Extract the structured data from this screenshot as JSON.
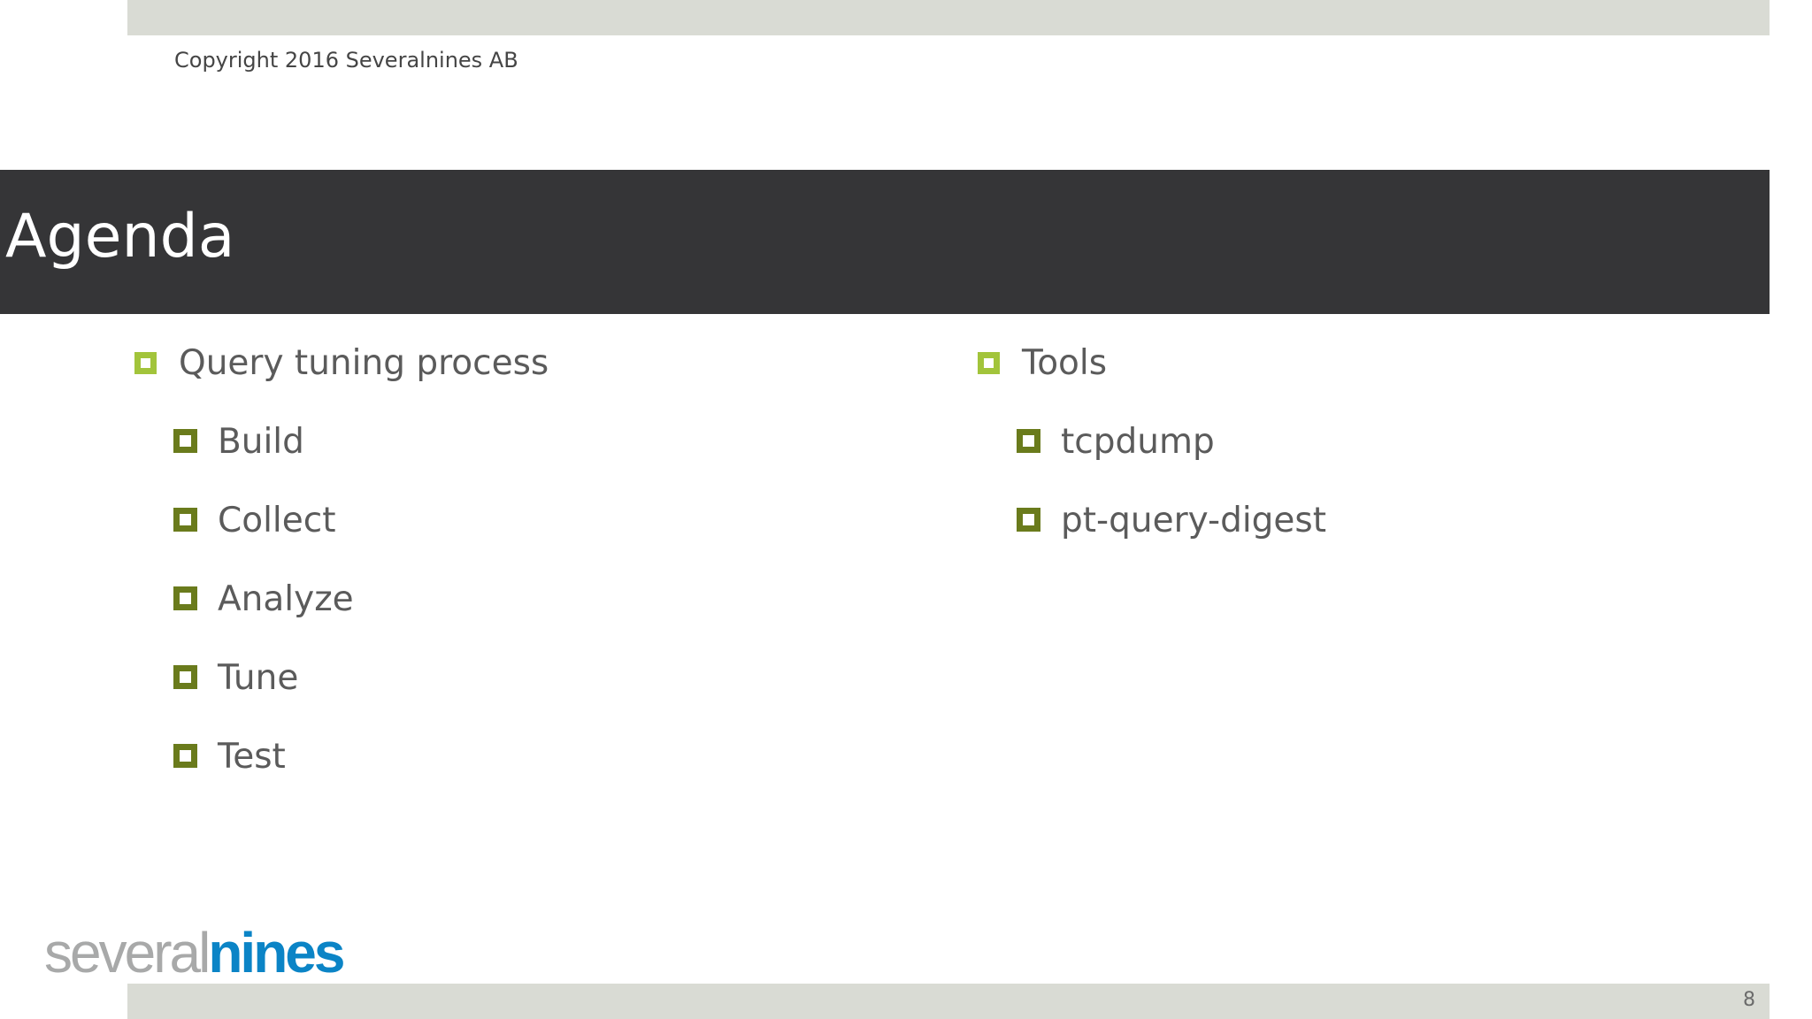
{
  "header": {
    "copyright": "Copyright 2016 Severalnines AB"
  },
  "slide": {
    "title": "Agenda",
    "left_column": {
      "heading": "Query tuning process",
      "items": [
        "Build",
        "Collect",
        "Analyze",
        "Tune",
        "Test"
      ]
    },
    "right_column": {
      "heading": "Tools",
      "items": [
        "tcpdump",
        "pt-query-digest"
      ]
    }
  },
  "footer": {
    "logo": {
      "part1": "several",
      "part2": "nines"
    },
    "page_number": "8"
  },
  "colors": {
    "title_bar": "#353537",
    "band": "#d9dbd4",
    "bullet_level1": "#a2c43b",
    "bullet_level2": "#6a7b1c",
    "logo_gray": "#a8a9a9",
    "logo_blue": "#0b84c6"
  },
  "icons": {
    "level1_bullet": "square-bullet-icon",
    "level2_bullet": "square-bullet-icon"
  }
}
